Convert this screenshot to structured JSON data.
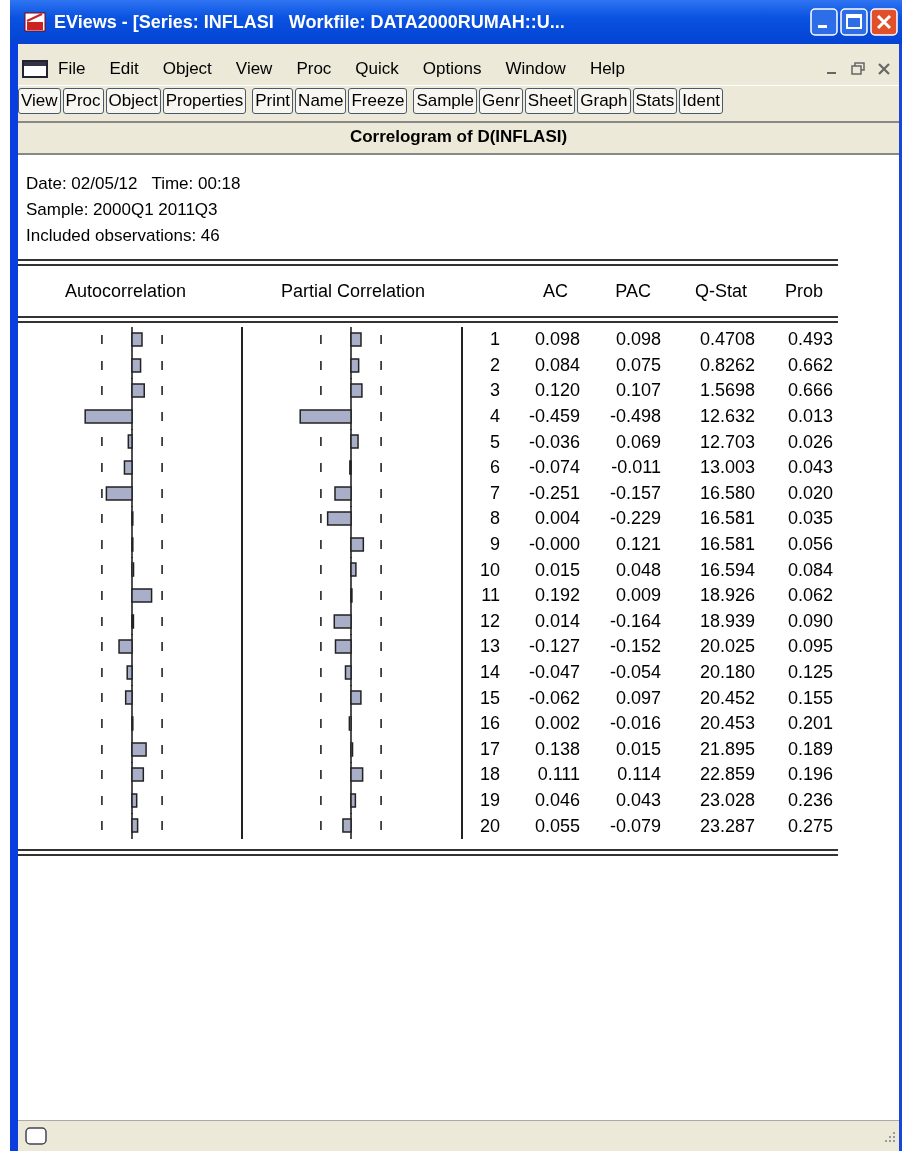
{
  "window": {
    "title": "EViews - [Series: INFLASI   Workfile: DATA2000RUMAH::U..."
  },
  "menu": [
    "File",
    "Edit",
    "Object",
    "View",
    "Proc",
    "Quick",
    "Options",
    "Window",
    "Help"
  ],
  "toolbar": [
    [
      "View",
      "Proc",
      "Object",
      "Properties"
    ],
    [
      "Print",
      "Name",
      "Freeze"
    ],
    [
      "Sample",
      "Genr",
      "Sheet",
      "Graph",
      "Stats",
      "Ident"
    ]
  ],
  "view_title": "Correlogram of D(INFLASI)",
  "info": [
    "Date: 02/05/12   Time: 00:18",
    "Sample: 2000Q1 2011Q3",
    "Included observations: 46"
  ],
  "columns": [
    "Autocorrelation",
    "Partial Correlation",
    "AC",
    "PAC",
    "Q-Stat",
    "Prob"
  ],
  "rows": [
    {
      "lag": "1",
      "ac": "0.098",
      "pac": "0.098",
      "q_stat": "0.4708",
      "prob": "0.493"
    },
    {
      "lag": "2",
      "ac": "0.084",
      "pac": "0.075",
      "q_stat": "0.8262",
      "prob": "0.662"
    },
    {
      "lag": "3",
      "ac": "0.120",
      "pac": "0.107",
      "q_stat": "1.5698",
      "prob": "0.666"
    },
    {
      "lag": "4",
      "ac": "-0.459",
      "pac": "-0.498",
      "q_stat": "12.632",
      "prob": "0.013"
    },
    {
      "lag": "5",
      "ac": "-0.036",
      "pac": "0.069",
      "q_stat": "12.703",
      "prob": "0.026"
    },
    {
      "lag": "6",
      "ac": "-0.074",
      "pac": "-0.011",
      "q_stat": "13.003",
      "prob": "0.043"
    },
    {
      "lag": "7",
      "ac": "-0.251",
      "pac": "-0.157",
      "q_stat": "16.580",
      "prob": "0.020"
    },
    {
      "lag": "8",
      "ac": "0.004",
      "pac": "-0.229",
      "q_stat": "16.581",
      "prob": "0.035"
    },
    {
      "lag": "9",
      "ac": "-0.000",
      "pac": "0.121",
      "q_stat": "16.581",
      "prob": "0.056"
    },
    {
      "lag": "10",
      "ac": "0.015",
      "pac": "0.048",
      "q_stat": "16.594",
      "prob": "0.084"
    },
    {
      "lag": "11",
      "ac": "0.192",
      "pac": "0.009",
      "q_stat": "18.926",
      "prob": "0.062"
    },
    {
      "lag": "12",
      "ac": "0.014",
      "pac": "-0.164",
      "q_stat": "18.939",
      "prob": "0.090"
    },
    {
      "lag": "13",
      "ac": "-0.127",
      "pac": "-0.152",
      "q_stat": "20.025",
      "prob": "0.095"
    },
    {
      "lag": "14",
      "ac": "-0.047",
      "pac": "-0.054",
      "q_stat": "20.180",
      "prob": "0.125"
    },
    {
      "lag": "15",
      "ac": "-0.062",
      "pac": "0.097",
      "q_stat": "20.452",
      "prob": "0.155"
    },
    {
      "lag": "16",
      "ac": "0.002",
      "pac": "-0.016",
      "q_stat": "20.453",
      "prob": "0.201"
    },
    {
      "lag": "17",
      "ac": "0.138",
      "pac": "0.015",
      "q_stat": "21.895",
      "prob": "0.189"
    },
    {
      "lag": "18",
      "ac": "0.111",
      "pac": "0.114",
      "q_stat": "22.859",
      "prob": "0.196"
    },
    {
      "lag": "19",
      "ac": "0.046",
      "pac": "0.043",
      "q_stat": "23.028",
      "prob": "0.236"
    },
    {
      "lag": "20",
      "ac": "0.055",
      "pac": "-0.079",
      "q_stat": "23.287",
      "prob": "0.275"
    }
  ]
}
